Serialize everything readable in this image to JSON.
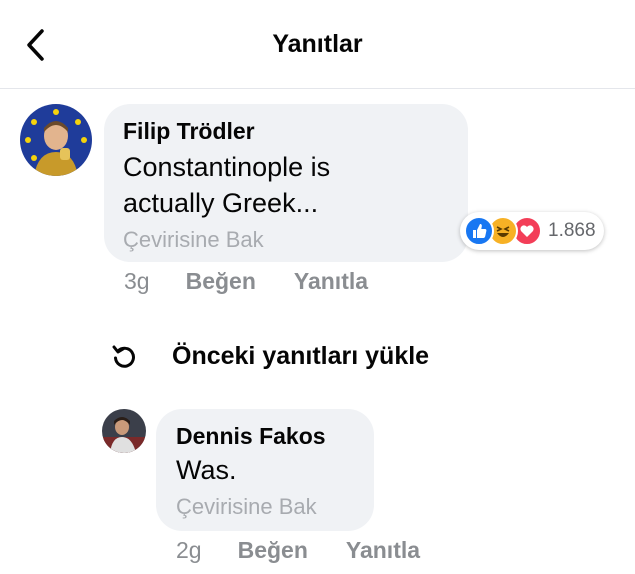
{
  "header": {
    "title": "Yanıtlar",
    "back_icon": "chevron-left-icon"
  },
  "comments": [
    {
      "author": "Filip Trödler",
      "text_line1": "Constantinople is",
      "text_line2": "actually Greek...",
      "see_translation": "Çevirisine Bak",
      "time": "3g",
      "like": "Beğen",
      "reply": "Yanıtla",
      "reactions": {
        "icons": [
          "like-icon",
          "haha-icon",
          "love-icon"
        ],
        "count": "1.868"
      }
    },
    {
      "author": "Dennis Fakos",
      "text": "Was.",
      "see_translation": "Çevirisine Bak",
      "time": "2g",
      "like": "Beğen",
      "reply": "Yanıtla"
    }
  ],
  "load_previous": {
    "label": "Önceki yanıtları yükle",
    "icon": "refresh-icon"
  },
  "colors": {
    "bubble": "#f0f2f5",
    "like_blue": "#1877f2",
    "haha_yellow": "#f7b125",
    "love_red": "#f33e58",
    "muted": "#8a8d91"
  }
}
